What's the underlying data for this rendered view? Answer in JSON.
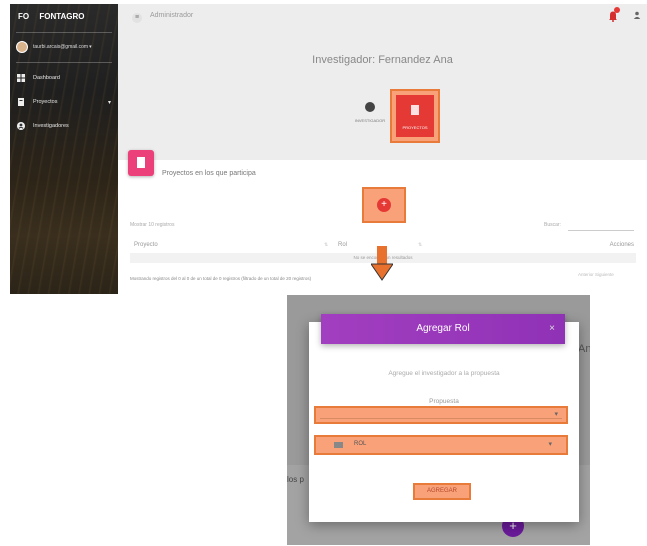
{
  "sidebar": {
    "brand_short": "FO",
    "brand_name": "FONTAGRO",
    "user_email": "taurbi.arcais@gmail.com",
    "user_caret": "▾",
    "items": [
      {
        "label": "Dashboard",
        "icon": "dashboard-icon"
      },
      {
        "label": "Proyectos",
        "icon": "folder-icon",
        "arrow": "▾"
      },
      {
        "label": "Investigadores",
        "icon": "person-icon"
      }
    ]
  },
  "topbar": {
    "menu_icon": "≡",
    "title": "Administrador",
    "user_icon": "person-icon"
  },
  "profile": {
    "heading": "Investigador: Fernandez Ana",
    "tab_investigador": "INVESTIGADOR",
    "tab_proyectos": "PROYECTOS"
  },
  "card": {
    "title": "Proyectos en los que participa",
    "add_symbol": "+",
    "mostrar": "Mostrar 10 registros",
    "buscar": "Buscar:",
    "columns": [
      "Proyecto",
      "Rol",
      "Acciones"
    ],
    "empty_message": "No se encontraron resultados",
    "info": "Mostrando registros del 0 al 0 de un total de 0 registros (filtrado de un total de 20 registros)",
    "pager": "Anterior  Siguiente"
  },
  "modal": {
    "title": "Agregar Rol",
    "close": "×",
    "subtitle": "Agregue el investigador a la propuesta",
    "propuesta_label": "Propuesta",
    "rol_value": "ROL",
    "submit": "AGREGAR",
    "bg_text_right": "Ana",
    "bg_text_left": "los p",
    "bg_add": "+"
  },
  "colors": {
    "highlight_fill": "#f9a27a",
    "highlight_border": "#e87a3a",
    "modal_header": "#9b38bd",
    "accent_red": "#e53935",
    "accent_pink": "#ec407a"
  }
}
